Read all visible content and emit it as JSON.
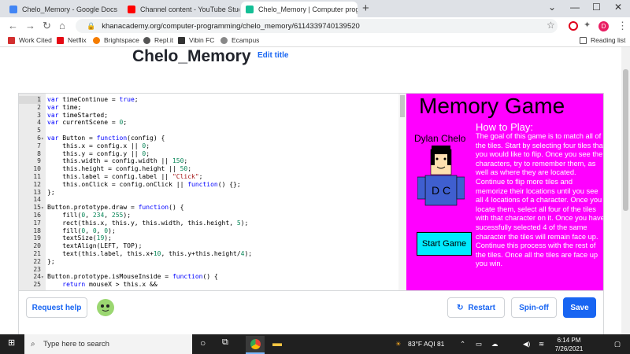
{
  "browser": {
    "tabs": [
      {
        "title": "Chelo_Memory - Google Docs",
        "active": false
      },
      {
        "title": "Channel content - YouTube Studi",
        "active": false
      },
      {
        "title": "Chelo_Memory | Computer prog",
        "active": true
      }
    ],
    "url": "khanacademy.org/computer-programming/chelo_memory/6114339740139520",
    "bookmarks": [
      "Work Cited",
      "Netflix",
      "Brightspace",
      "Repl.it",
      "Vibin FC",
      "Ecampus"
    ],
    "reading_list": "Reading list",
    "profile_initial": "D"
  },
  "page": {
    "title": "Chelo_Memory",
    "edit_title": "Edit title"
  },
  "code_lines": [
    {
      "n": "1",
      "fold": "",
      "code": "var timeContinue = true;"
    },
    {
      "n": "2",
      "fold": "",
      "code": "var time;"
    },
    {
      "n": "3",
      "fold": "",
      "code": "var timeStarted;"
    },
    {
      "n": "4",
      "fold": "",
      "code": "var currentScene = 0;"
    },
    {
      "n": "5",
      "fold": "",
      "code": ""
    },
    {
      "n": "6",
      "fold": "▾",
      "code": "var Button = function(config) {"
    },
    {
      "n": "7",
      "fold": "",
      "code": "    this.x = config.x || 0;"
    },
    {
      "n": "8",
      "fold": "",
      "code": "    this.y = config.y || 0;"
    },
    {
      "n": "9",
      "fold": "",
      "code": "    this.width = config.width || 150;"
    },
    {
      "n": "10",
      "fold": "",
      "code": "    this.height = config.height || 50;"
    },
    {
      "n": "11",
      "fold": "",
      "code": "    this.label = config.label || \"Click\";"
    },
    {
      "n": "12",
      "fold": "",
      "code": "    this.onClick = config.onClick || function() {};"
    },
    {
      "n": "13",
      "fold": "",
      "code": "};"
    },
    {
      "n": "14",
      "fold": "",
      "code": ""
    },
    {
      "n": "15",
      "fold": "▾",
      "code": "Button.prototype.draw = function() {"
    },
    {
      "n": "16",
      "fold": "",
      "code": "    fill(0, 234, 255);"
    },
    {
      "n": "17",
      "fold": "",
      "code": "    rect(this.x, this.y, this.width, this.height, 5);"
    },
    {
      "n": "18",
      "fold": "",
      "code": "    fill(0, 0, 0);"
    },
    {
      "n": "19",
      "fold": "",
      "code": "    textSize(19);"
    },
    {
      "n": "20",
      "fold": "",
      "code": "    textAlign(LEFT, TOP);"
    },
    {
      "n": "21",
      "fold": "",
      "code": "    text(this.label, this.x+10, this.y+this.height/4);"
    },
    {
      "n": "22",
      "fold": "",
      "code": "};"
    },
    {
      "n": "23",
      "fold": "",
      "code": ""
    },
    {
      "n": "24",
      "fold": "▾",
      "code": "Button.prototype.isMouseInside = function() {"
    },
    {
      "n": "25",
      "fold": "",
      "code": "    return mouseX > this.x &&"
    }
  ],
  "game": {
    "title": "Memory Game",
    "author": "Dylan Chelo",
    "how_to_title": "How to Play:",
    "how_to_text": "The goal of this game is to match all of the tiles.  Start by selecting four tiles that you would like to flip.  Once you see the characters, try to remember them, as well as where they are located.  Continue to flip more tiles and memorize their locations until you see all 4 locations of a character.  Once you locate them, select all four of the tiles with that character on it.  Once you have sucessfully selected 4 of the same character the tiles will remain face up.  Continue this process with the rest of the tiles.  Once all the tiles are face up you win.",
    "start_button": "Start Game",
    "shirt_text": "D C"
  },
  "toolbar": {
    "request_help": "Request help",
    "restart": "Restart",
    "spinoff": "Spin-off",
    "save": "Save"
  },
  "taskbar": {
    "search_placeholder": "Type here to search",
    "weather": "83°F  AQI 81",
    "time": "6:14 PM",
    "date": "7/26/2021"
  },
  "colors": {
    "accent": "#1865f2",
    "canvas_bg": "#ff00ff",
    "button_bg": "#00eaff"
  }
}
